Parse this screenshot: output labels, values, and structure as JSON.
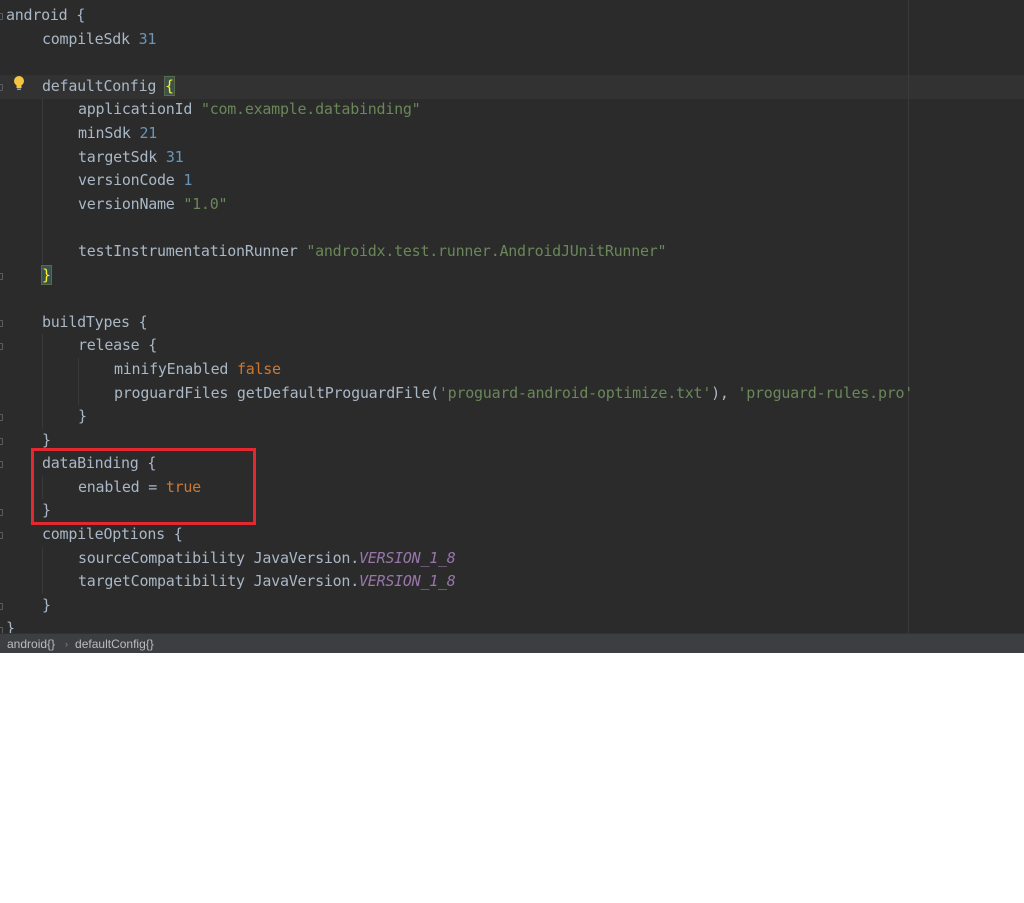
{
  "editor": {
    "lines": [
      [
        {
          "t": "android {"
        }
      ],
      [
        {
          "t": "compileSdk "
        },
        {
          "t": "31",
          "c": "num"
        }
      ],
      [],
      [
        {
          "t": "defaultConfig "
        },
        {
          "t": "{",
          "c": "brace-hl"
        }
      ],
      [
        {
          "t": "applicationId "
        },
        {
          "t": "\"com.example.databinding\"",
          "c": "str"
        }
      ],
      [
        {
          "t": "minSdk "
        },
        {
          "t": "21",
          "c": "num"
        }
      ],
      [
        {
          "t": "targetSdk "
        },
        {
          "t": "31",
          "c": "num"
        }
      ],
      [
        {
          "t": "versionCode "
        },
        {
          "t": "1",
          "c": "num"
        }
      ],
      [
        {
          "t": "versionName "
        },
        {
          "t": "\"1.0\"",
          "c": "str"
        }
      ],
      [],
      [
        {
          "t": "testInstrumentationRunner "
        },
        {
          "t": "\"androidx.test.runner.AndroidJUnitRunner\"",
          "c": "str"
        }
      ],
      [
        {
          "t": "}",
          "c": "brace-hl"
        }
      ],
      [],
      [
        {
          "t": "buildTypes {"
        }
      ],
      [
        {
          "t": "release {"
        }
      ],
      [
        {
          "t": "minifyEnabled "
        },
        {
          "t": "false",
          "c": "kw"
        }
      ],
      [
        {
          "t": "proguardFiles getDefaultProguardFile("
        },
        {
          "t": "'proguard-android-optimize.txt'",
          "c": "str"
        },
        {
          "t": "), "
        },
        {
          "t": "'proguard-rules.pro'",
          "c": "str"
        }
      ],
      [
        {
          "t": "}"
        }
      ],
      [
        {
          "t": "}"
        }
      ],
      [
        {
          "t": "dataBinding {"
        }
      ],
      [
        {
          "t": "enabled = "
        },
        {
          "t": "true",
          "c": "kw"
        }
      ],
      [
        {
          "t": "}"
        }
      ],
      [
        {
          "t": "compileOptions {"
        }
      ],
      [
        {
          "t": "sourceCompatibility JavaVersion."
        },
        {
          "t": "VERSION_1_8",
          "c": "const"
        }
      ],
      [
        {
          "t": "targetCompatibility JavaVersion."
        },
        {
          "t": "VERSION_1_8",
          "c": "const"
        }
      ],
      [
        {
          "t": "}"
        }
      ],
      [
        {
          "t": "}"
        }
      ]
    ],
    "indents": [
      0,
      1,
      0,
      1,
      2,
      2,
      2,
      2,
      2,
      2,
      2,
      1,
      0,
      1,
      2,
      3,
      3,
      2,
      1,
      1,
      2,
      1,
      1,
      2,
      2,
      1,
      0
    ]
  },
  "breadcrumbs": {
    "items": [
      "android{}",
      "defaultConfig{}"
    ],
    "separator": "›"
  },
  "icons": {
    "intention": "lightbulb-icon"
  },
  "colors": {
    "background": "#2b2b2b",
    "text": "#a9b7c6",
    "number": "#6897bb",
    "string": "#6a8759",
    "keyword": "#cc7832",
    "constant": "#9876aa",
    "highlight_box": "#e3282f"
  }
}
